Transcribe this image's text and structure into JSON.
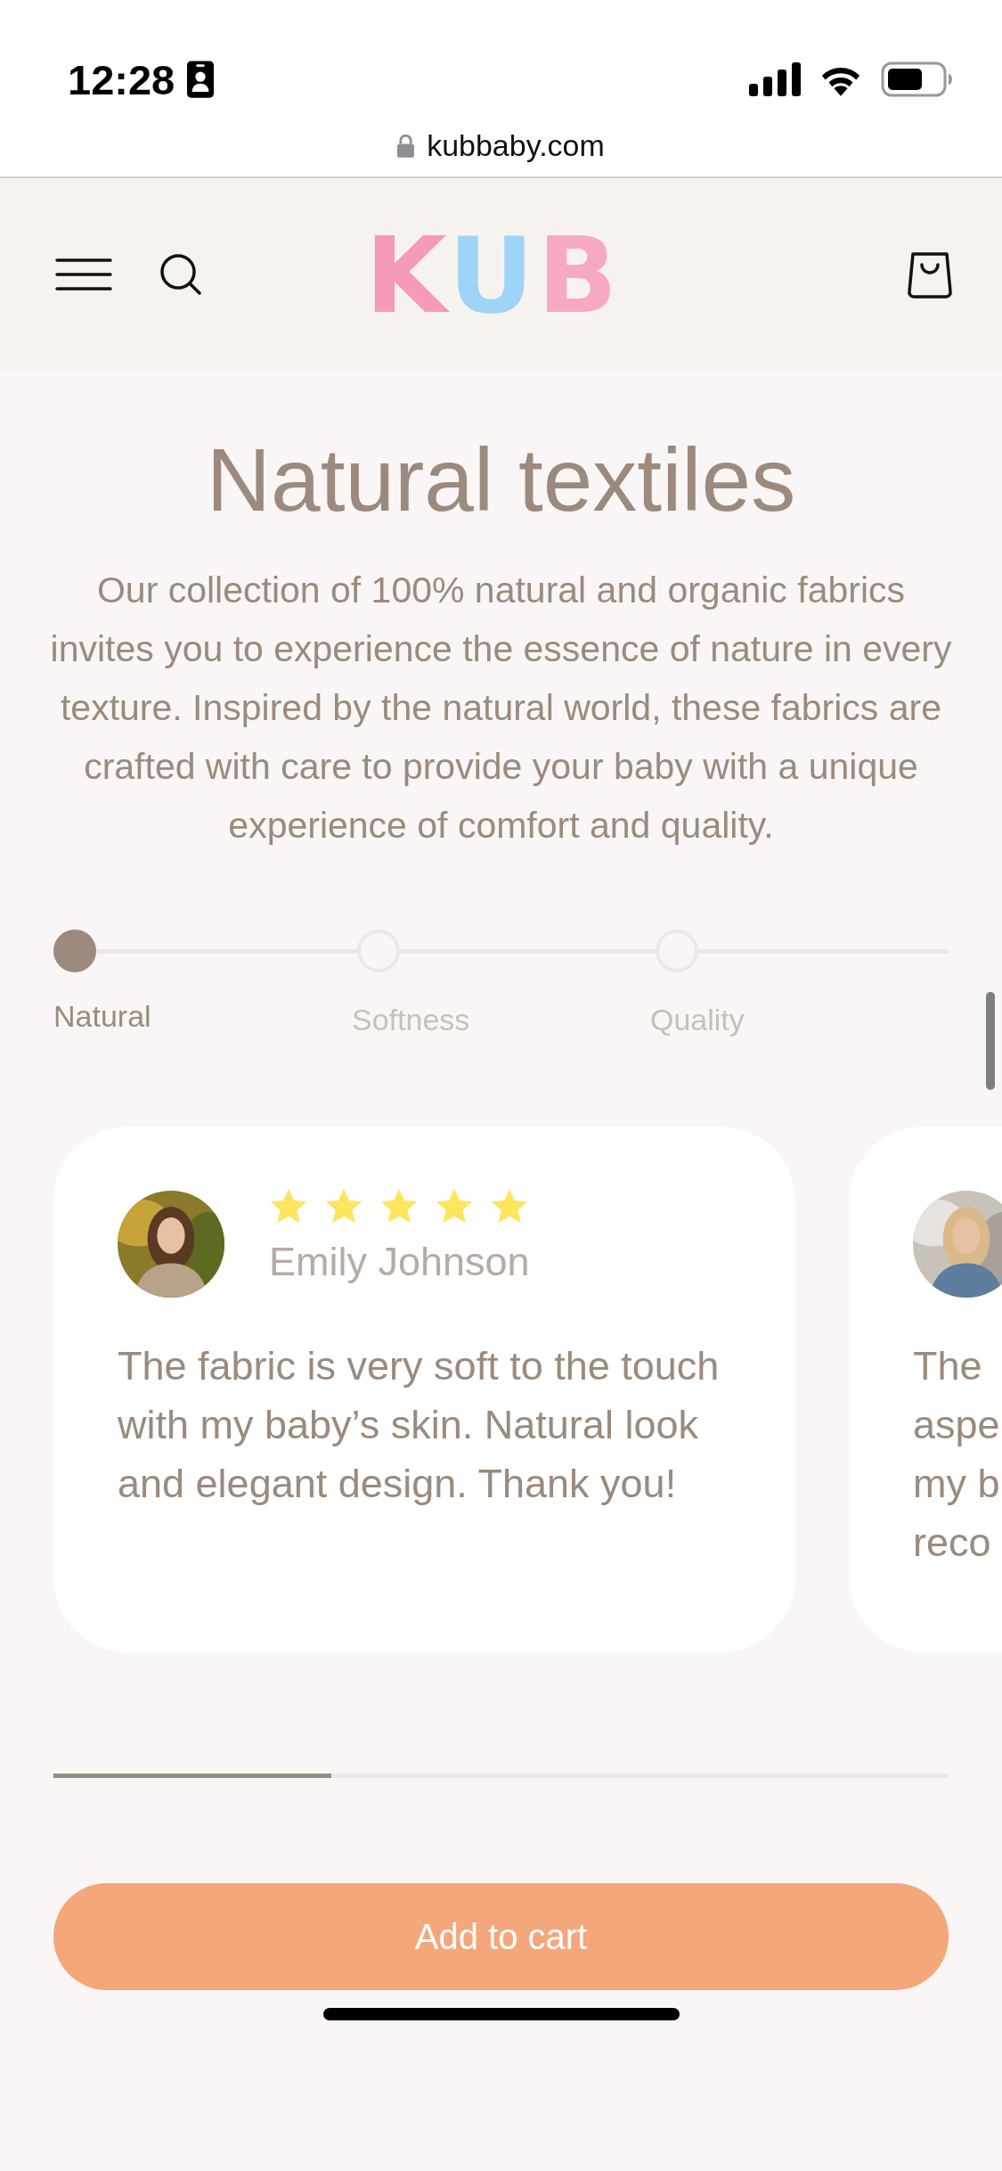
{
  "status_bar": {
    "time": "12:28"
  },
  "browser": {
    "url": "kubbaby.com"
  },
  "header": {
    "logo": "KUB"
  },
  "hero": {
    "title": "Natural textiles",
    "text": "Our collection of 100% natural and organic fabrics invites you to experience the essence of nature in every texture. Inspired by the natural world, these fabrics are crafted with care to provide your baby with a unique experience of comfort and quality."
  },
  "steps": [
    {
      "label": "Natural",
      "selected": true
    },
    {
      "label": "Softness",
      "selected": false
    },
    {
      "label": "Quality",
      "selected": false
    }
  ],
  "reviews": [
    {
      "name": "Emily Johnson",
      "stars": 5,
      "lines": [
        "The fabric is very soft to the touch with my baby’s skin. Natural look and elegant design. Thank you!"
      ]
    },
    {
      "lines": [
        "The",
        "aspe",
        "my b",
        "reco"
      ]
    }
  ],
  "carousel": {
    "level": 0.31
  },
  "button": {
    "label": "Add to cart"
  }
}
